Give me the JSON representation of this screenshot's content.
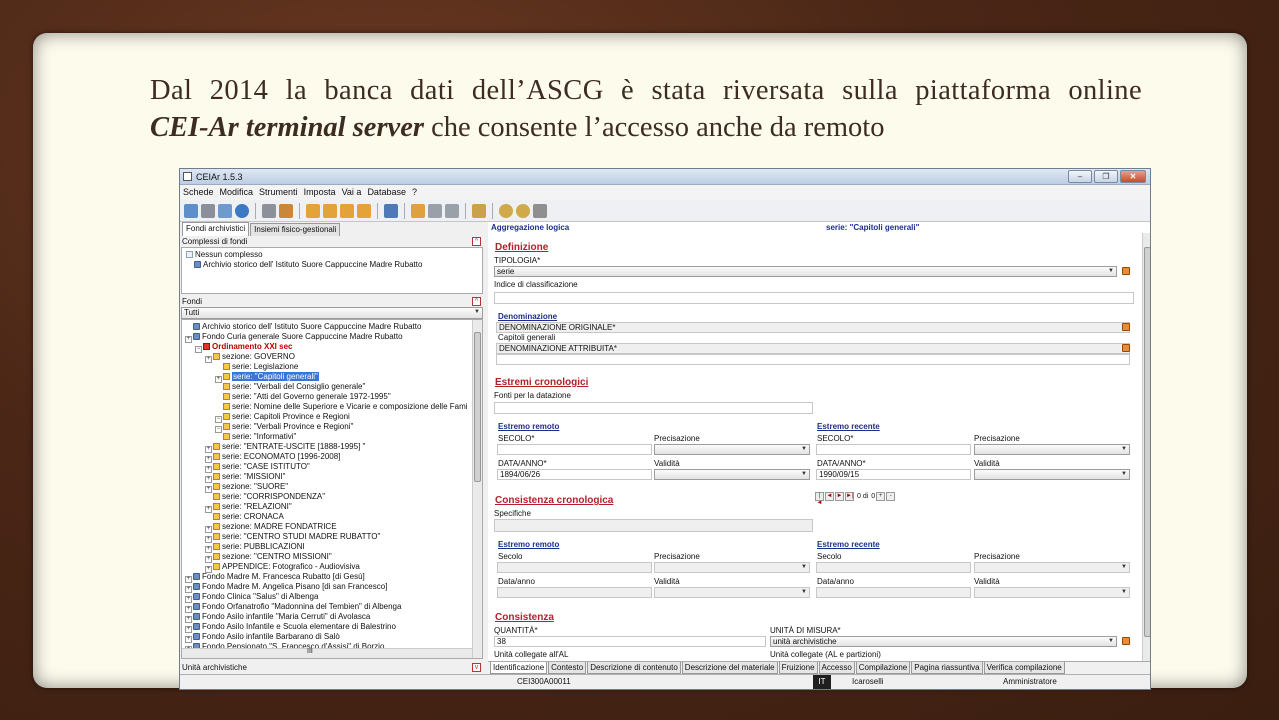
{
  "slide": {
    "title_line1": "Dal 2014 la banca dati dell’ASCG è stata riversata sulla piattaforma online",
    "title_em": "CEI-Ar terminal server",
    "title_rest": " che consente l’accesso anche da remoto"
  },
  "app": {
    "window_title": "CEIAr 1.5.3",
    "window_buttons": [
      "–",
      "❐",
      "✕"
    ],
    "menu": [
      "Schede",
      "Modifica",
      "Strumenti",
      "Imposta",
      "Vai a",
      "Database",
      "?"
    ],
    "toolbar_icons": [
      "add-icon",
      "copy-icon",
      "move-icon",
      "refresh-icon",
      "group-icon",
      "link-icon",
      "up-top-icon",
      "up-icon",
      "down-icon",
      "down-bottom-icon",
      "print-icon",
      "edit-icon",
      "pen-icon",
      "eraser-icon",
      "book-icon",
      "search-icon",
      "search-zoom-icon",
      "key-icon"
    ],
    "colors": {
      "accent_red": "#b3202a",
      "link_blue": "#1a2f8a",
      "selection": "#3875d7"
    },
    "left": {
      "tabs": [
        "Fondi archivistici",
        "Insiemi fisico-gestionali"
      ],
      "complessi_header": "Complessi di fondi",
      "complessi": [
        "Nessun complesso",
        "Archivio storico dell' Istituto Suore Cappuccine Madre Rubatto"
      ],
      "fondi_header": "Fondi",
      "fondi_filter": "Tutti",
      "tree": [
        {
          "t": "Archivio storico dell' Istituto Suore Cappuccine Madre Rubatto",
          "lvl": 0
        },
        {
          "t": "Fondo Curia generale Suore Cappuccine Madre Rubatto",
          "lvl": 0
        },
        {
          "t": "Ordinamento XXI sec",
          "lvl": 1
        },
        {
          "t": "sezione: GOVERNO",
          "lvl": 2
        },
        {
          "t": "serie: Legislazione",
          "lvl": 3
        },
        {
          "t": "serie: \"Capitoli generali\"",
          "lvl": 3
        },
        {
          "t": "serie: \"Verbali del Consiglio generale\"",
          "lvl": 3
        },
        {
          "t": "serie: \"Atti del Governo generale 1972-1995\"",
          "lvl": 3
        },
        {
          "t": "serie: Nomine delle Superiore e Vicarie e composizione delle Fami",
          "lvl": 3
        },
        {
          "t": "serie: Capitoli Province e Regioni",
          "lvl": 3
        },
        {
          "t": "serie: \"Verbali Province e Regioni\"",
          "lvl": 3
        },
        {
          "t": "serie: \"Informativi\"",
          "lvl": 3
        },
        {
          "t": "serie: \"ENTRATE-USCITE [1888-1995] \"",
          "lvl": 2
        },
        {
          "t": "serie: ECONOMATO [1996-2008]",
          "lvl": 2
        },
        {
          "t": "serie: \"CASE ISTITUTO\"",
          "lvl": 2
        },
        {
          "t": "serie: \"MISSIONI\"",
          "lvl": 2
        },
        {
          "t": "sezione: \"SUORE\"",
          "lvl": 2
        },
        {
          "t": "serie: \"CORRISPONDENZA\"",
          "lvl": 2
        },
        {
          "t": "serie: \"RELAZIONI\"",
          "lvl": 2
        },
        {
          "t": "serie: CRONACA",
          "lvl": 2
        },
        {
          "t": "sezione: MADRE FONDATRICE",
          "lvl": 2
        },
        {
          "t": "serie: \"CENTRO STUDI MADRE RUBATTO\"",
          "lvl": 2
        },
        {
          "t": "serie: PUBBLICAZIONI",
          "lvl": 2
        },
        {
          "t": "sezione: \"CENTRO MISSIONI\"",
          "lvl": 2
        },
        {
          "t": "APPENDICE: Fotografico - Audiovisiva",
          "lvl": 2
        },
        {
          "t": "Fondo Madre M. Francesca Rubatto [di Gesù]",
          "lvl": 0
        },
        {
          "t": "Fondo Madre M. Angelica Pisano [di san Francesco]",
          "lvl": 0
        },
        {
          "t": "Fondo Clinica \"Salus\" di Albenga",
          "lvl": 0
        },
        {
          "t": "Fondo Orfanatrofio \"Madonnina del Tembien\" di  Albenga",
          "lvl": 0
        },
        {
          "t": "Fondo Asilo infantile \"Maria Cerruti\" di Avolasca",
          "lvl": 0
        },
        {
          "t": "Fondo Asilo Infantile e Scuola elementare di Balestrino",
          "lvl": 0
        },
        {
          "t": "Fondo Asilo infantile Barbarano di Salò",
          "lvl": 0
        },
        {
          "t": "Fondo Pensionato \"S. Francesco d'Assisi\" di Borzio",
          "lvl": 0
        }
      ],
      "hscroll_label": "III",
      "unita_label": "Unità archivistiche"
    },
    "right": {
      "aggregazione": "Aggregazione logica",
      "serie_header": "serie: \"Capitoli generali\"",
      "definizione": "Definizione",
      "tipologia_label": "TIPOLOGIA*",
      "tipologia_value": "serie",
      "indice_label": "Indice di classificazione",
      "denominazione": "Denominazione",
      "den_orig_label": "DENOMINAZIONE ORIGINALE*",
      "den_orig_value": "Capitoli generali",
      "den_attr_label": "DENOMINAZIONE ATTRIBUITA*",
      "estremi": "Estremi cronologici",
      "fonti_label": "Fonti per la datazione",
      "estremo_remoto": "Estremo remoto",
      "estremo_recente": "Estremo recente",
      "secolo_label": "SECOLO*",
      "precisazione_label": "Precisazione",
      "data_label": "DATA/ANNO*",
      "validita_label": "Validità",
      "data_remoto": "1894/06/26",
      "data_recente": "1990/09/15",
      "consistenza_cron": "Consistenza cronologica",
      "specifiche_label": "Specifiche",
      "nav_counter": "0 di",
      "nav_total": "0",
      "secolo2_label": "Secolo",
      "dataanno2_label": "Data/anno",
      "consistenza": "Consistenza",
      "quantita_label": "QUANTITÀ*",
      "quantita_value": "38",
      "unita_misura_label": "UNITÀ DI MISURA*",
      "unita_misura_value": "unità archivistiche",
      "unita_al_label": "Unità collegate all'AL",
      "unita_alp_label": "Unità collegate (AL e partizioni)"
    },
    "bottom_tabs": [
      "Identificazione",
      "Contesto",
      "Descrizione di contenuto",
      "Descrizione del materiale",
      "Fruizione",
      "Accesso",
      "Compilazione",
      "Pagina riassuntiva",
      "Verifica compilazione"
    ],
    "status": {
      "code": "CEI300A00011",
      "lang": "IT",
      "user": "Icaroselli",
      "role": "Amministratore"
    }
  }
}
